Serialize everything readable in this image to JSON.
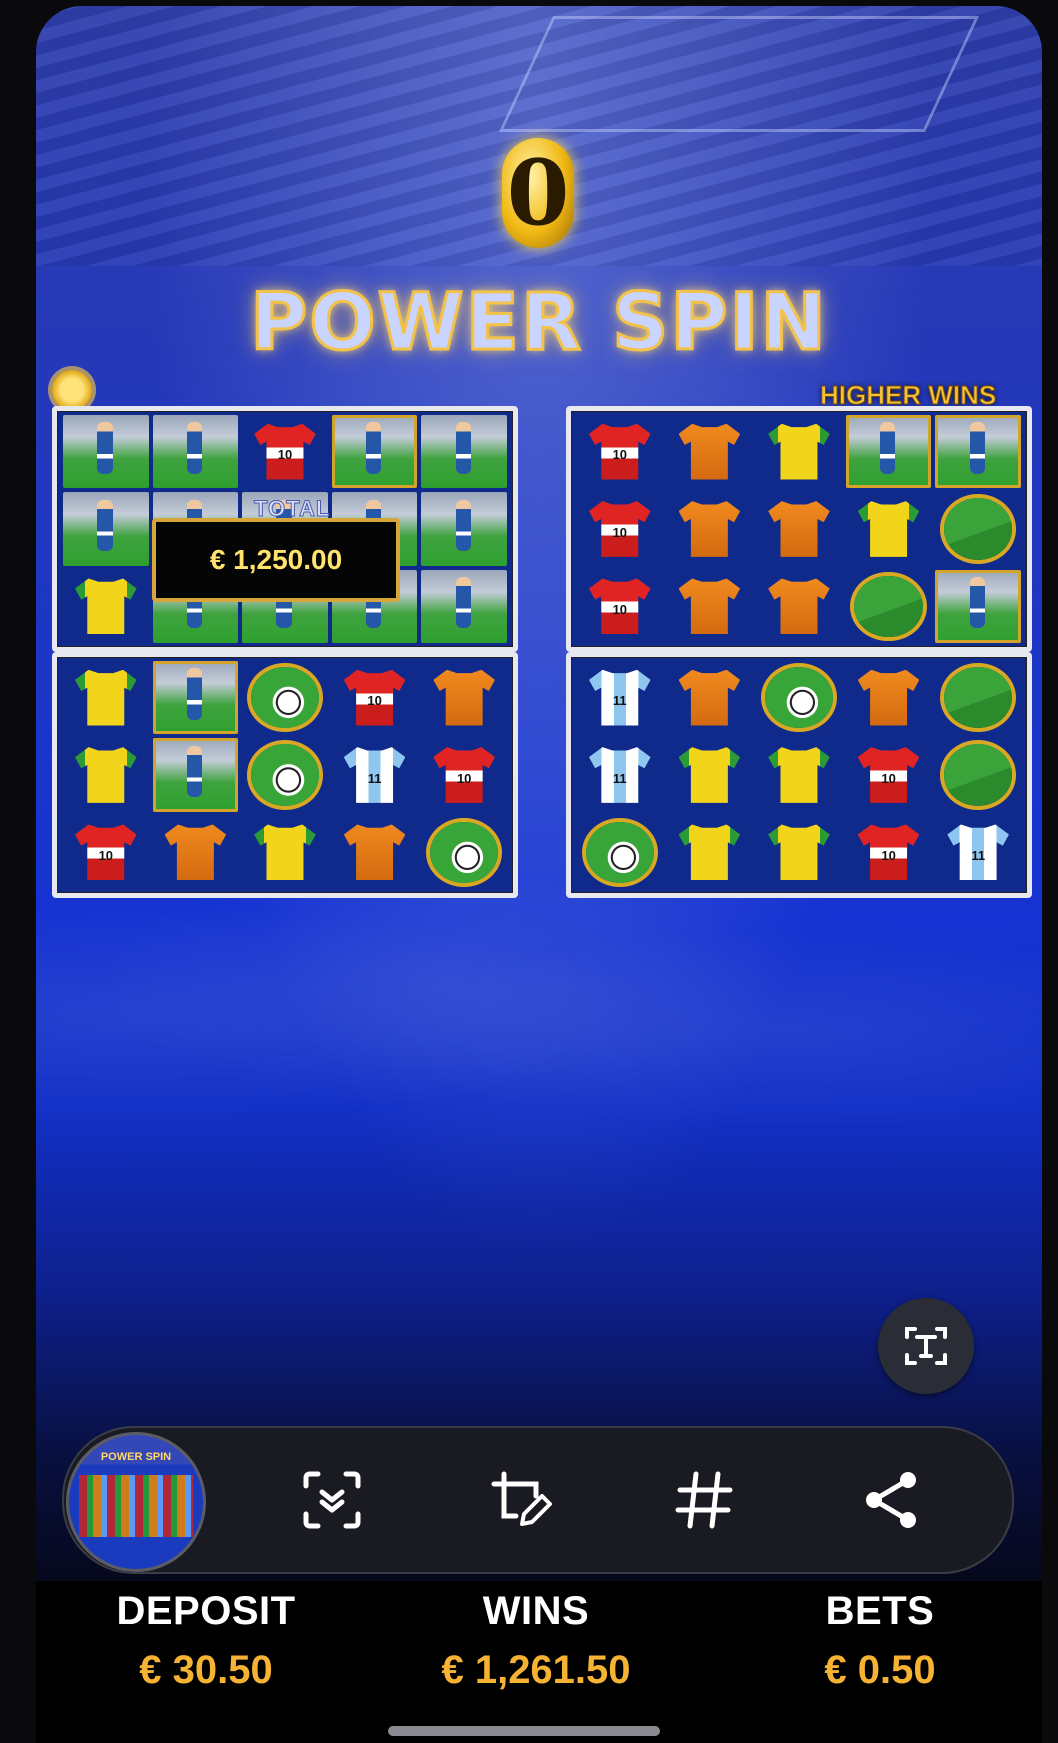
{
  "game": {
    "counter": "0",
    "title": "POWER SPIN",
    "higher_wins": "HIGHER WINS",
    "total_label": "TOTAL",
    "total_value": "€ 1,250.00",
    "grids": [
      [
        [
          "player",
          "player",
          "shirt-red-10",
          "player-framed",
          "player"
        ],
        [
          "player",
          "player",
          "player",
          "player",
          "player"
        ],
        [
          "shirt-yellow",
          "player",
          "player",
          "player",
          "player"
        ]
      ],
      [
        [
          "shirt-red-10",
          "shirt-orange",
          "shirt-yellow",
          "player-framed",
          "player-framed"
        ],
        [
          "shirt-red-10",
          "shirt-orange",
          "shirt-orange",
          "shirt-yellow",
          "goal"
        ],
        [
          "shirt-red-10",
          "shirt-orange",
          "shirt-orange",
          "goal",
          "player-framed"
        ]
      ],
      [
        [
          "shirt-yellow",
          "player-framed",
          "ball",
          "shirt-red-10",
          "shirt-orange"
        ],
        [
          "shirt-yellow",
          "player-framed",
          "ball",
          "shirt-argen-11",
          "shirt-red-10"
        ],
        [
          "shirt-red-10",
          "shirt-orange",
          "shirt-yellow",
          "shirt-orange",
          "ball"
        ]
      ],
      [
        [
          "shirt-argen-11",
          "shirt-orange",
          "ball",
          "shirt-orange",
          "goal"
        ],
        [
          "shirt-argen-11",
          "shirt-yellow",
          "shirt-yellow",
          "shirt-red-10",
          "goal"
        ],
        [
          "ball",
          "shirt-yellow",
          "shirt-yellow",
          "shirt-red-10",
          "shirt-argen-11"
        ]
      ]
    ]
  },
  "toolbar": {
    "thumbnail_label": "POWER SPIN",
    "buttons": [
      "scroll-capture-icon",
      "draw-crop-icon",
      "hashtag-icon",
      "share-icon"
    ]
  },
  "stats": {
    "deposit_label": "DEPOSIT",
    "deposit_value": "€ 30.50",
    "wins_label": "WINS",
    "wins_value": "€ 1,261.50",
    "bets_label": "BETS",
    "bets_value": "€ 0.50"
  },
  "colors": {
    "accent_gold": "#f6b232",
    "game_blue": "#1533d2"
  }
}
